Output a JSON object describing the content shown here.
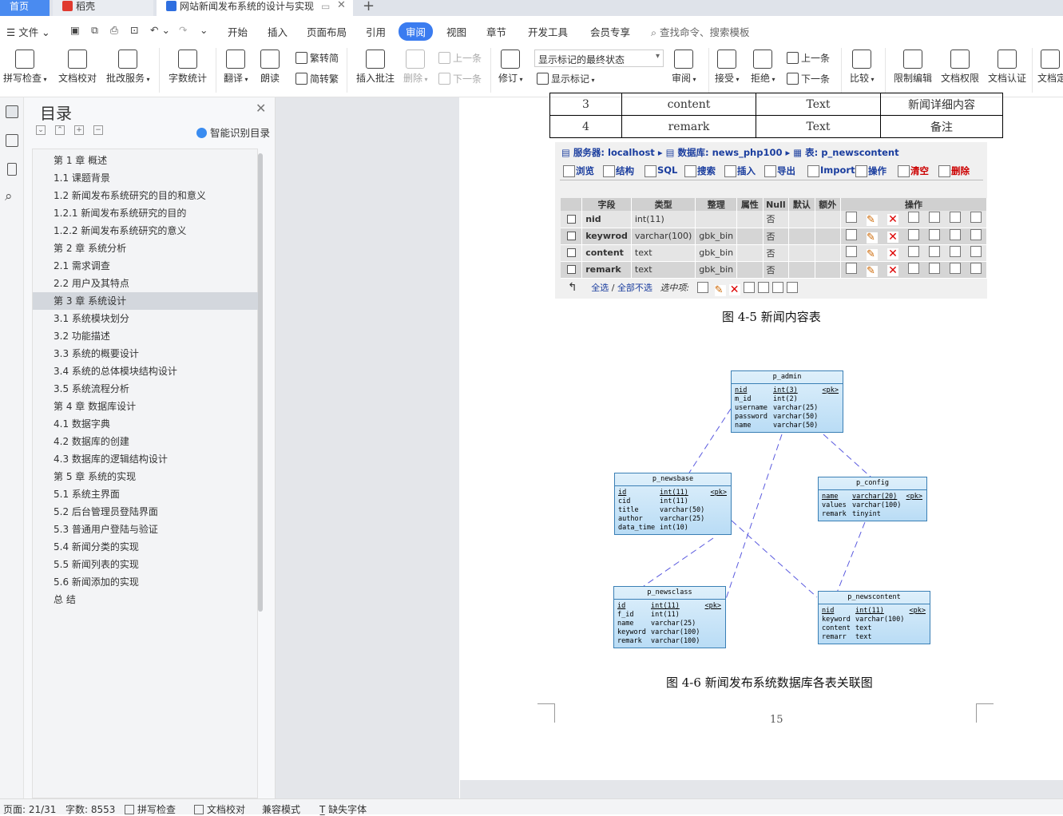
{
  "tabs": [
    {
      "label": "首页",
      "active": false
    },
    {
      "label": "稻壳",
      "active": false
    },
    {
      "label": "网站新闻发布系统的设计与实现",
      "active": true
    }
  ],
  "menus": [
    "文件",
    "开始",
    "插入",
    "页面布局",
    "引用",
    "审阅",
    "视图",
    "章节",
    "开发工具",
    "会员专享"
  ],
  "active_menu": "审阅",
  "search_placeholder": "查找命令、搜索模板",
  "ribbon": {
    "spell": "拼写检查",
    "proof": "文档校对",
    "annotate": "批改服务",
    "wordcount": "字数统计",
    "translate": "翻译",
    "read": "朗读",
    "to_trad": "繁转简",
    "to_simp": "简转繁",
    "insert_comment": "插入批注",
    "delete": "删除",
    "prev_comment": "上一条",
    "next_comment": "下一条",
    "revise": "修订",
    "status_select": "显示标记的最终状态",
    "show_marks": "显示标记",
    "review": "审阅",
    "accept": "接受",
    "reject": "拒绝",
    "prev_change": "上一条",
    "next_change": "下一条",
    "compare": "比较",
    "restrict": "限制编辑",
    "permission": "文档权限",
    "certify": "文档认证",
    "more": "文档定"
  },
  "toc": {
    "title": "目录",
    "smart": "智能识别目录",
    "items": [
      "第 1 章  概述",
      "1.1  课题背景",
      "1.2 新闻发布系统研究的目的和意义",
      "1.2.1 新闻发布系统研究的目的",
      "1.2.2 新闻发布系统研究的意义",
      "第 2 章  系统分析",
      "2.1 需求调查",
      "2.2 用户及其特点",
      "第 3 章  系统设计",
      "3.1 系统模块划分",
      "3.2  功能描述",
      "3.3 系统的概要设计",
      "3.4  系统的总体模块结构设计",
      "3.5 系统流程分析",
      "第 4 章  数据库设计",
      "4.1 数据字典",
      "4.2 数据库的创建",
      "4.3 数据库的逻辑结构设计",
      "第 5 章  系统的实现",
      "5.1  系统主界面",
      "5.2  后台管理员登陆界面",
      "5.3  普通用户登陆与验证",
      "5.4 新闻分类的实现",
      "5.5  新闻列表的实现",
      "5.6  新闻添加的实现",
      "总    结"
    ],
    "selected_index": 8
  },
  "doc": {
    "top_table": [
      [
        "3",
        "content",
        "Text",
        "新闻详细内容"
      ],
      [
        "4",
        "remark",
        "Text",
        "备注"
      ]
    ],
    "pma": {
      "server_label": "服务器:",
      "server": "localhost",
      "db_label": "数据库:",
      "db": "news_php100",
      "table_label": "表:",
      "table": "p_newscontent",
      "tabs": [
        "浏览",
        "结构",
        "SQL",
        "搜索",
        "插入",
        "导出",
        "Import",
        "操作",
        "清空",
        "删除"
      ],
      "headers": [
        "字段",
        "类型",
        "整理",
        "属性",
        "Null",
        "默认",
        "额外",
        "操作"
      ],
      "rows": [
        [
          "nid",
          "int(11)",
          "",
          "否"
        ],
        [
          "keywrod",
          "varchar(100)",
          "gbk_bin",
          "否"
        ],
        [
          "content",
          "text",
          "gbk_bin",
          "否"
        ],
        [
          "remark",
          "text",
          "gbk_bin",
          "否"
        ]
      ],
      "select_all": "全选",
      "deselect_all": "全部不选",
      "selected": "选中项:"
    },
    "caption_1": "图  4-5  新闻内容表",
    "caption_2": "图 4-6  新闻发布系统数据库各表关联图",
    "page_number": "15",
    "er": {
      "admin": {
        "name": "p_admin",
        "rows": [
          [
            "nid",
            "int(3)",
            "<pk>"
          ],
          [
            "m_id",
            "int(2)",
            ""
          ],
          [
            "username",
            "varchar(25)",
            ""
          ],
          [
            "password",
            "varchar(50)",
            ""
          ],
          [
            "name",
            "varchar(50)",
            ""
          ]
        ]
      },
      "newsbase": {
        "name": "p_newsbase",
        "rows": [
          [
            "id",
            "int(11)",
            "<pk>"
          ],
          [
            "cid",
            "int(11)",
            ""
          ],
          [
            "title",
            "varchar(50)",
            ""
          ],
          [
            "author",
            "varchar(25)",
            ""
          ],
          [
            "data_time",
            "int(10)",
            ""
          ]
        ]
      },
      "config": {
        "name": "p_config",
        "rows": [
          [
            "name",
            "varchar(20)",
            "<pk>"
          ],
          [
            "values",
            "varchar(100)",
            ""
          ],
          [
            "remark",
            "tinyint",
            ""
          ]
        ]
      },
      "newsclass": {
        "name": "p_newsclass",
        "rows": [
          [
            "id",
            "int(11)",
            "<pk>"
          ],
          [
            "f_id",
            "int(11)",
            ""
          ],
          [
            "name",
            "varchar(25)",
            ""
          ],
          [
            "keyword",
            "varchar(100)",
            ""
          ],
          [
            "remark",
            "varchar(100)",
            ""
          ]
        ]
      },
      "newscontent": {
        "name": "p_newscontent",
        "rows": [
          [
            "nid",
            "int(11)",
            "<pk>"
          ],
          [
            "keyword",
            "varchar(100)",
            ""
          ],
          [
            "content",
            "text",
            ""
          ],
          [
            "remarr",
            "text",
            ""
          ]
        ]
      }
    }
  },
  "status": {
    "page": "页面: 21/31",
    "words": "字数: 8553",
    "spell": "拼写检查",
    "proof": "文档校对",
    "compat": "兼容模式",
    "missing_font": "缺失字体"
  }
}
